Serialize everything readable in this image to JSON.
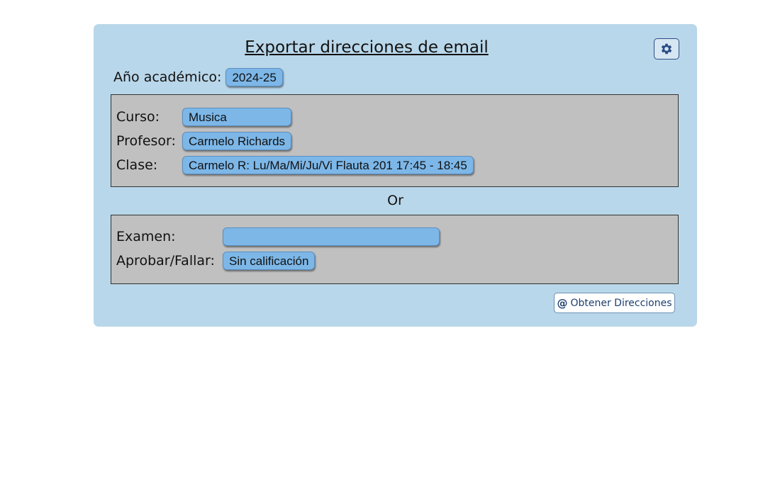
{
  "title": "Exportar direcciones de email",
  "settings": {
    "icon": "gear-icon"
  },
  "year": {
    "label": "Año académico:",
    "value": "2024-25"
  },
  "course": {
    "label": "Curso:",
    "value": "Musica"
  },
  "teacher": {
    "label": "Profesor:",
    "value": "Carmelo Richards"
  },
  "class": {
    "label": "Clase:",
    "value": "Carmelo R: Lu/Ma/Mi/Ju/Vi Flauta 201 17:45 - 18:45"
  },
  "separator": "Or",
  "exam": {
    "label": "Examen:",
    "value": ""
  },
  "passfail": {
    "label": "Aprobar/Fallar:",
    "value": "Sin calificación"
  },
  "get_button": {
    "icon": "at-icon",
    "label": "Obtener Direcciones"
  },
  "colors": {
    "panel": "#b9d7ea",
    "box": "#c0c0c0",
    "pill": "#7db7e8",
    "accent": "#2b4d86"
  }
}
